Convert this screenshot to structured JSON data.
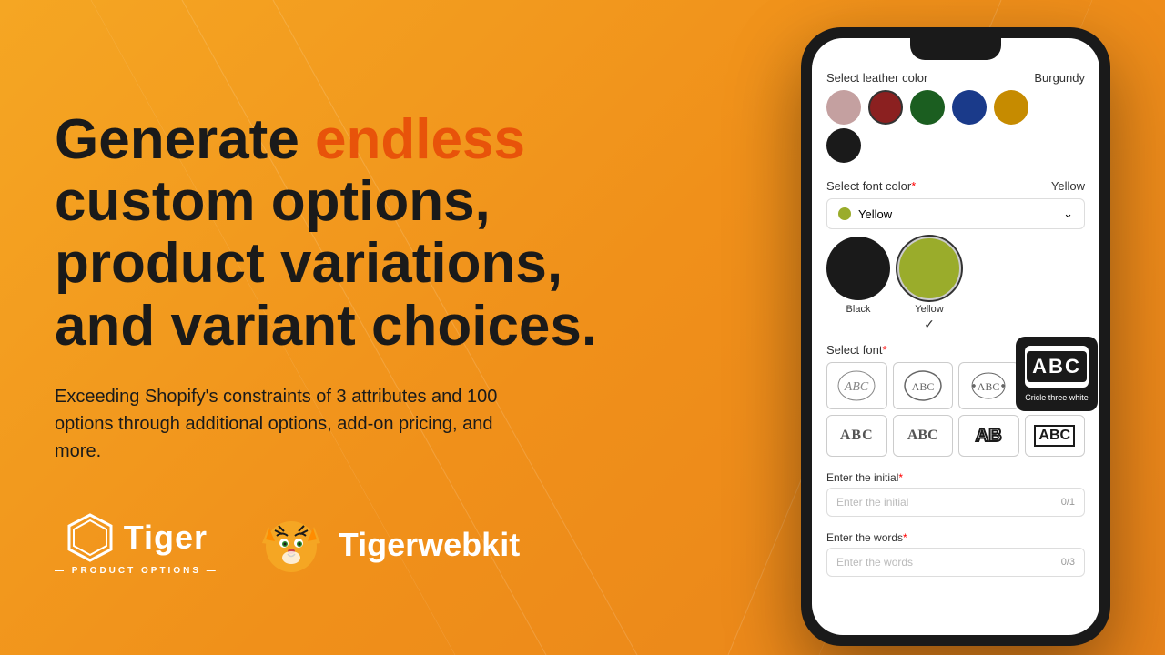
{
  "background": {
    "gradient_start": "#F5A623",
    "gradient_end": "#E8831A"
  },
  "headline": {
    "part1": "Generate ",
    "accent": "endless",
    "part2": " custom options, product variations, and variant choices."
  },
  "subtext": "Exceeding Shopify's constraints of 3 attributes and 100 options through additional options, add-on pricing, and more.",
  "logo_tiger": {
    "name": "Tiger",
    "sub": "— PRODUCT OPTIONS —"
  },
  "logo_tigerwebkit": {
    "name": "Tigerwebkit"
  },
  "phone": {
    "leather_section": {
      "title": "Select leather color",
      "selected_value": "Burgundy",
      "colors": [
        {
          "name": "Mauve",
          "hex": "#C4A0A0"
        },
        {
          "name": "Burgundy",
          "hex": "#8B2020",
          "selected": true
        },
        {
          "name": "Forest Green",
          "hex": "#1B5E20"
        },
        {
          "name": "Navy Blue",
          "hex": "#1A3A8A"
        },
        {
          "name": "Mustard",
          "hex": "#C68B00"
        },
        {
          "name": "Black",
          "hex": "#1a1a1a"
        }
      ]
    },
    "font_color_section": {
      "title": "Select font color",
      "required": true,
      "selected_value": "Yellow",
      "dropdown_label": "Yellow",
      "colors": [
        {
          "name": "Black",
          "hex": "#1a1a1a"
        },
        {
          "name": "Yellow",
          "hex": "#9aac2b",
          "selected": true
        }
      ]
    },
    "font_section": {
      "title": "Select font",
      "required": true,
      "fonts": [
        {
          "label": "ABC",
          "style": "circle-thin",
          "id": "font1"
        },
        {
          "label": "ABC",
          "style": "circle-medium",
          "id": "font2"
        },
        {
          "label": "ABC",
          "style": "circle-wreath",
          "id": "font3"
        },
        {
          "label": "ABC",
          "style": "circle-three-white",
          "id": "font4",
          "selected": true,
          "tooltip": "Cricle three white"
        },
        {
          "label": "ABC",
          "style": "serif-outline",
          "id": "font5"
        },
        {
          "label": "ABC",
          "style": "script",
          "id": "font6"
        },
        {
          "label": "AB",
          "style": "bold-block",
          "id": "font7"
        },
        {
          "label": "ABC",
          "style": "block-outline",
          "id": "font8"
        }
      ]
    },
    "initial_section": {
      "title": "Enter the initial",
      "required": true,
      "placeholder": "Enter the initial",
      "counter": "0/1"
    },
    "words_section": {
      "title": "Enter the words",
      "required": true,
      "placeholder": "Enter the words",
      "counter": "0/3"
    }
  }
}
